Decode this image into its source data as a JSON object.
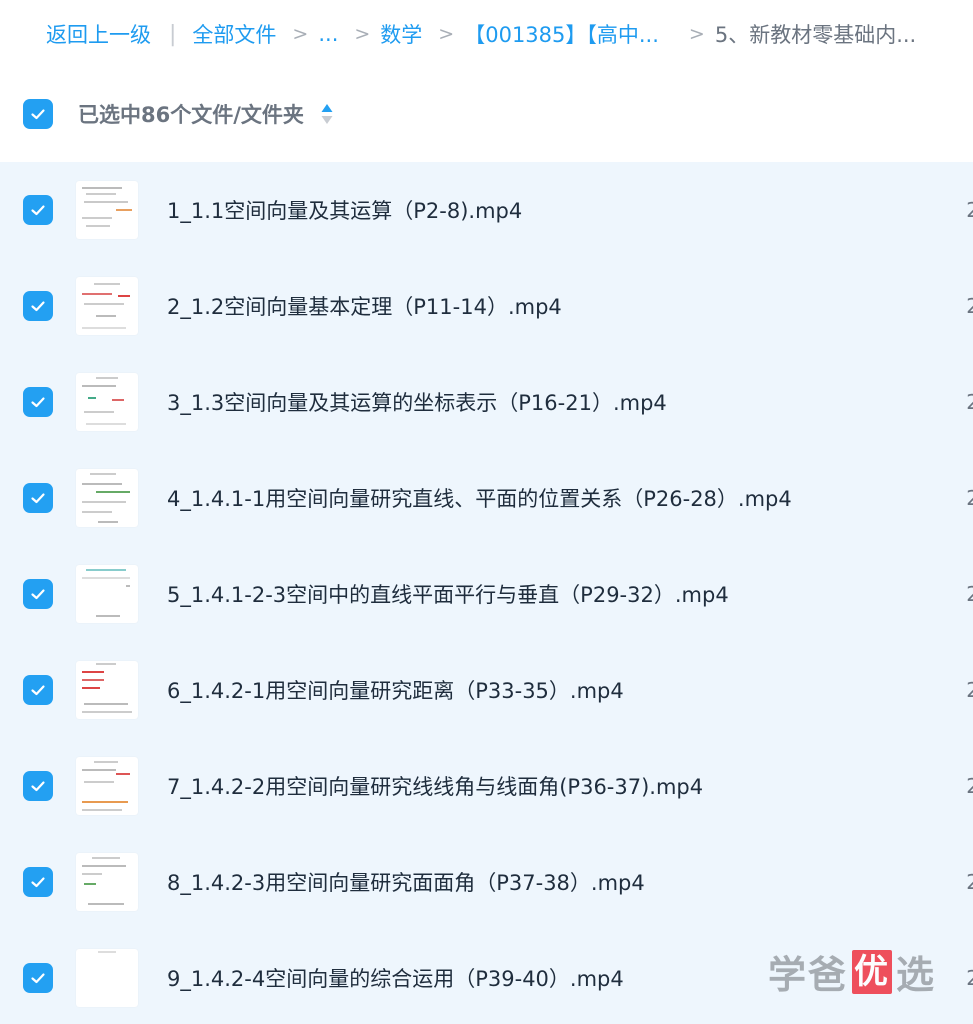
{
  "breadcrumb": {
    "back_label": "返回上一级",
    "divider": "|",
    "items": [
      "全部文件",
      "...",
      "数学",
      "【001385】【高中...",
      "5、新教材零基础内..."
    ],
    "separator": ">"
  },
  "header": {
    "selection_label": "已选中86个文件/文件夹"
  },
  "files": [
    {
      "name": "1_1.1空间向量及其运算（P2-8).mp4",
      "checked": true
    },
    {
      "name": "2_1.2空间向量基本定理（P11-14）.mp4",
      "checked": true
    },
    {
      "name": "3_1.3空间向量及其运算的坐标表示（P16-21）.mp4",
      "checked": true
    },
    {
      "name": "4_1.4.1-1用空间向量研究直线、平面的位置关系（P26-28）.mp4",
      "checked": true
    },
    {
      "name": "5_1.4.1-2-3空间中的直线平面平行与垂直（P29-32）.mp4",
      "checked": true
    },
    {
      "name": "6_1.4.2-1用空间向量研究距离（P33-35）.mp4",
      "checked": true
    },
    {
      "name": "7_1.4.2-2用空间向量研究线线角与线面角(P36-37).mp4",
      "checked": true
    },
    {
      "name": "8_1.4.2-3用空间向量研究面面角（P37-38）.mp4",
      "checked": true
    },
    {
      "name": "9_1.4.2-4空间向量的综合运用（P39-40）.mp4",
      "checked": true
    }
  ],
  "row_edge_text": "2",
  "watermark": {
    "part1": "学爸",
    "box": "优",
    "part2": "选"
  },
  "colors": {
    "accent": "#23a0f2",
    "link": "#1e9bf0",
    "list_bg": "#eef6fd"
  }
}
